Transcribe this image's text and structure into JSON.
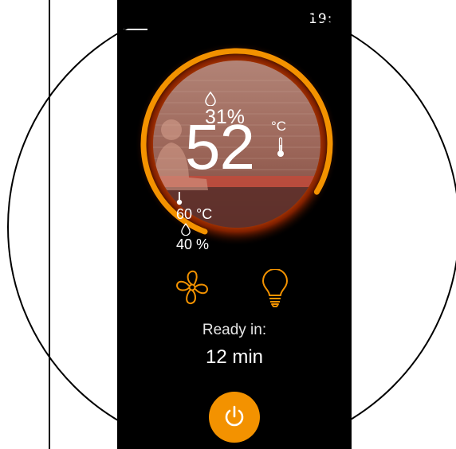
{
  "status_bar": {
    "time_fragment": "19:"
  },
  "dial": {
    "humidity_current": "31%",
    "temperature_current": "52",
    "temperature_unit": "°C",
    "target_temperature": "60 °C",
    "target_humidity": "40 %",
    "heating_progress": 0.78,
    "icons": [
      "droplet-icon",
      "thermometer-icon",
      "sauna-person-icon"
    ]
  },
  "controls": {
    "fan_icon": "fan-icon",
    "light_icon": "light-bulb-icon"
  },
  "ready": {
    "label": "Ready in:",
    "value": "12 min"
  },
  "power": {
    "icon": "power-icon"
  },
  "colors": {
    "accent": "#f39200",
    "glow": "#ff5a00",
    "background": "#000000",
    "dial_fill": "#9c6a5a"
  }
}
